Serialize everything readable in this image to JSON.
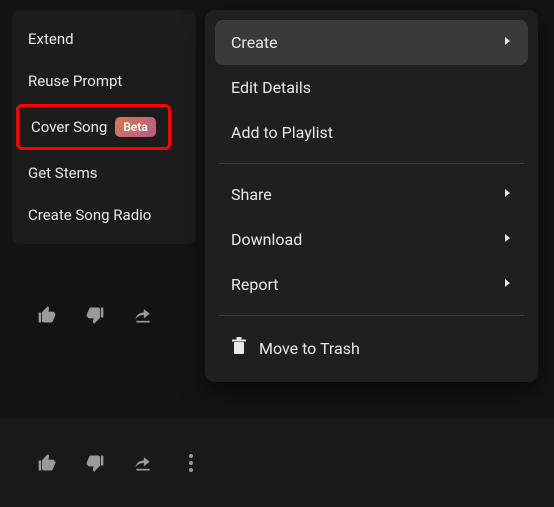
{
  "left_menu": {
    "items": [
      {
        "label": "Extend"
      },
      {
        "label": "Reuse Prompt"
      },
      {
        "label": "Cover Song",
        "badge": "Beta",
        "highlighted": true
      },
      {
        "label": "Get Stems"
      },
      {
        "label": "Create Song Radio"
      }
    ]
  },
  "right_menu": {
    "items": [
      {
        "label": "Create",
        "submenu": true,
        "hovered": true
      },
      {
        "label": "Edit Details"
      },
      {
        "label": "Add to Playlist"
      }
    ],
    "items2": [
      {
        "label": "Share",
        "submenu": true
      },
      {
        "label": "Download",
        "submenu": true
      },
      {
        "label": "Report",
        "submenu": true
      }
    ],
    "trash": {
      "label": "Move to Trash"
    }
  }
}
